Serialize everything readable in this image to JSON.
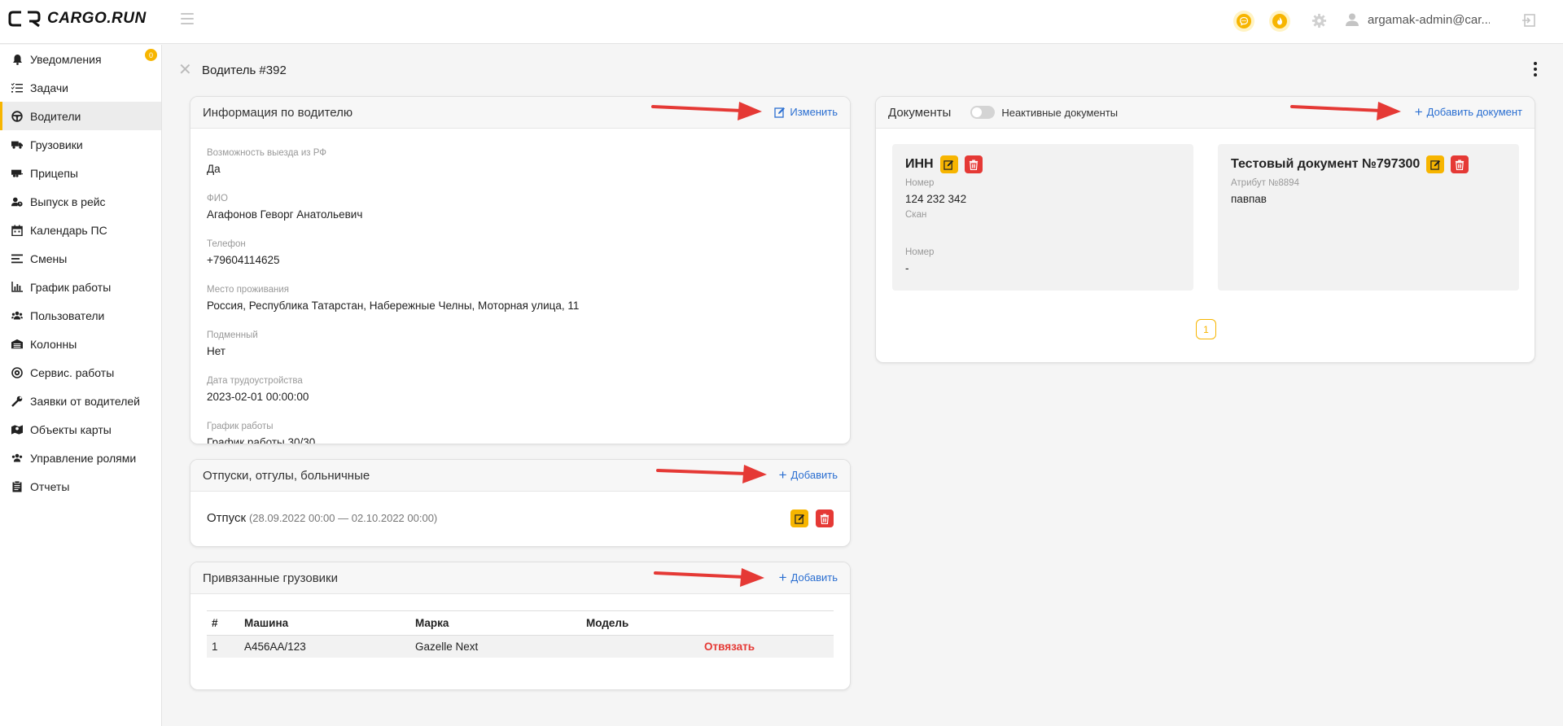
{
  "header": {
    "logo_text": "CARGO.RUN",
    "user_name": "argamak-admin@car...",
    "icons": [
      "chat-icon",
      "fire-icon",
      "gear-icon",
      "user-icon",
      "logout-icon"
    ]
  },
  "sidebar": {
    "badge": "0",
    "items": [
      {
        "label": "Уведомления",
        "icon": "bell-icon"
      },
      {
        "label": "Задачи",
        "icon": "tasks-icon"
      },
      {
        "label": "Водители",
        "icon": "steering-wheel-icon",
        "active": true
      },
      {
        "label": "Грузовики",
        "icon": "truck-icon"
      },
      {
        "label": "Прицепы",
        "icon": "trailer-icon"
      },
      {
        "label": "Выпуск в рейс",
        "icon": "user-clock-icon"
      },
      {
        "label": "Календарь ПС",
        "icon": "calendar-icon"
      },
      {
        "label": "Смены",
        "icon": "bars-icon"
      },
      {
        "label": "График работы",
        "icon": "chart-icon"
      },
      {
        "label": "Пользователи",
        "icon": "users-icon"
      },
      {
        "label": "Колонны",
        "icon": "garage-icon"
      },
      {
        "label": "Сервис. работы",
        "icon": "service-icon"
      },
      {
        "label": "Заявки от водителей",
        "icon": "wrench-icon"
      },
      {
        "label": "Объекты карты",
        "icon": "map-icon"
      },
      {
        "label": "Управление ролями",
        "icon": "roles-icon"
      },
      {
        "label": "Отчеты",
        "icon": "report-icon"
      }
    ]
  },
  "page": {
    "title": "Водитель #392"
  },
  "driver_info": {
    "title": "Информация по водителю",
    "action": "Изменить",
    "fields": [
      {
        "label": "Возможность выезда из РФ",
        "value": "Да"
      },
      {
        "label": "ФИО",
        "value": "Агафонов Геворг Анатольевич"
      },
      {
        "label": "Телефон",
        "value": "+79604114625"
      },
      {
        "label": "Место проживания",
        "value": "Россия, Республика Татарстан, Набережные Челны, Моторная улица, 11"
      },
      {
        "label": "Подменный",
        "value": "Нет"
      },
      {
        "label": "Дата трудоустройства",
        "value": "2023-02-01 00:00:00"
      },
      {
        "label": "График работы",
        "value": "График работы 30/30"
      }
    ]
  },
  "vacations": {
    "title": "Отпуски, отгулы, больничные",
    "action": "Добавить",
    "item_type": "Отпуск",
    "item_range": "(28.09.2022 00:00 — 02.10.2022 00:00)"
  },
  "trucks": {
    "title": "Привязанные грузовики",
    "action": "Добавить",
    "columns": [
      "#",
      "Машина",
      "Марка",
      "Модель"
    ],
    "rows": [
      {
        "num": "1",
        "car": "А456АА/123",
        "brand": "Gazelle Next",
        "model": "",
        "action": "Отвязать"
      }
    ]
  },
  "documents": {
    "title": "Документы",
    "toggle_label": "Неактивные документы",
    "action": "Добавить документ",
    "items": [
      {
        "title": "ИНН",
        "fields": [
          {
            "label": "Номер",
            "value": "124 232 342"
          },
          {
            "label": "Скан",
            "value": ""
          },
          {
            "label": "Номер",
            "value": "-"
          }
        ]
      },
      {
        "title": "Тестовый документ №797300",
        "fields": [
          {
            "label": "Атрибут №8894",
            "value": "павпав"
          }
        ]
      }
    ],
    "page": "1"
  },
  "colors": {
    "accent": "#f7b500",
    "link": "#2b6fd1",
    "danger": "#e53935",
    "arrow": "#e53935"
  }
}
